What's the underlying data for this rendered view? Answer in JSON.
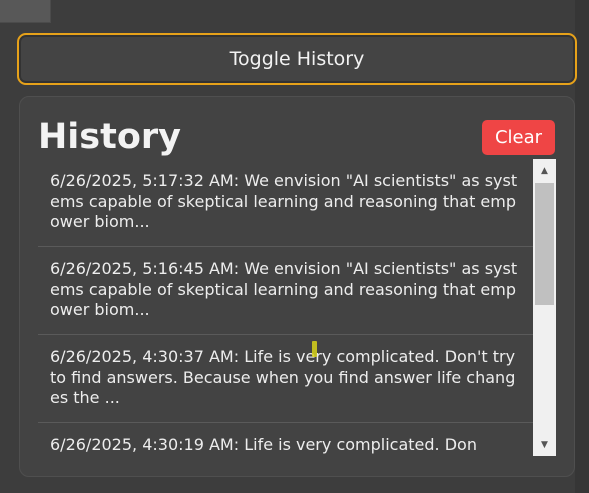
{
  "toggle_button": {
    "label": "Toggle History"
  },
  "history": {
    "title": "History",
    "clear_label": "Clear",
    "items": [
      {
        "text": "6/26/2025, 5:17:32 AM: We envision \"AI scientists\" as systems capable of skeptical learning and reasoning that empower biom..."
      },
      {
        "text": "6/26/2025, 5:16:45 AM: We envision \"AI scientists\" as systems capable of skeptical learning and reasoning that empower biom..."
      },
      {
        "text": "6/26/2025, 4:30:37 AM: Life is very complicated. Don't try to find answers. Because when you find answer life changes the ..."
      },
      {
        "text": "6/26/2025, 4:30:19 AM: Life is very complicated. Don"
      }
    ]
  },
  "icons": {
    "scroll_up": "scroll-up-arrow-icon",
    "scroll_down": "scroll-down-arrow-icon"
  },
  "colors": {
    "accent": "#e7a21a",
    "clear_button": "#ef4545",
    "panel_background": "#434343"
  }
}
